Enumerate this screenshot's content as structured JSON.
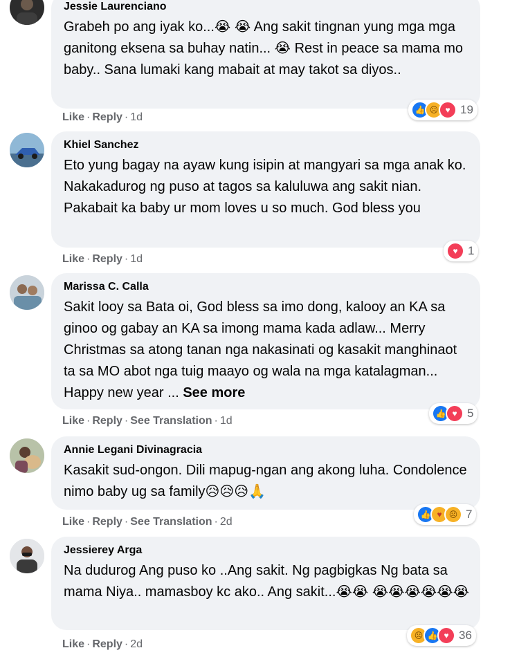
{
  "comments": [
    {
      "name": "Jessie Laurenciano",
      "text": "Grabeh po ang iyak ko...😭 😭 Ang sakit tingnan yung mga mga ganitong eksena sa buhay natin... 😭 Rest in peace sa mama mo baby.. Sana lumaki kang mabait at may takot sa diyos..",
      "actions": {
        "like": "Like",
        "reply": "Reply",
        "time": "1d"
      },
      "reactions": {
        "icons": [
          "like-icon",
          "sad-icon",
          "love-icon"
        ],
        "count": "19"
      }
    },
    {
      "name": "Khiel Sanchez",
      "text": "Eto yung bagay na ayaw kung isipin at mangyari sa mga anak ko. Nakakadurog ng puso at tagos sa kaluluwa ang sakit nian. Pakabait ka baby ur mom loves u so much. God bless you",
      "actions": {
        "like": "Like",
        "reply": "Reply",
        "time": "1d"
      },
      "reactions": {
        "icons": [
          "love-icon"
        ],
        "count": "1"
      }
    },
    {
      "name": "Marissa C. Calla",
      "text": "Sakit looy sa Bata oi, God bless sa imo dong, kalooy an KA sa ginoo og gabay an KA sa imong mama kada adlaw... Merry Christmas sa atong tanan nga nakasinati og kasakit manghinaot ta sa MO abot nga tuig maayo og wala na mga katalagman... Happy new year ...",
      "see_more": "See more",
      "actions": {
        "like": "Like",
        "reply": "Reply",
        "translate": "See Translation",
        "time": "1d"
      },
      "reactions": {
        "icons": [
          "like-icon",
          "love-icon"
        ],
        "count": "5"
      }
    },
    {
      "name": "Annie Legani Divinagracia",
      "text": "Kasakit sud-ongon. Dili mapug-ngan ang akong luha. Condolence nimo baby ug sa family😥😥😥🙏",
      "actions": {
        "like": "Like",
        "reply": "Reply",
        "translate": "See Translation",
        "time": "2d"
      },
      "reactions": {
        "icons": [
          "like-icon",
          "care-icon",
          "sad-icon"
        ],
        "count": "7"
      }
    },
    {
      "name": "Jessierey Arga",
      "text": "Na dudurog Ang puso ko ..Ang sakit. Ng pagbigkas Ng bata sa mama Niya.. mamasboy kc ako.. Ang sakit...😭😭 😭😭😭😭😭😭",
      "actions": {
        "like": "Like",
        "reply": "Reply",
        "time": "2d"
      },
      "reactions": {
        "icons": [
          "sad-icon",
          "like-icon",
          "love-icon"
        ],
        "count": "36"
      }
    }
  ]
}
